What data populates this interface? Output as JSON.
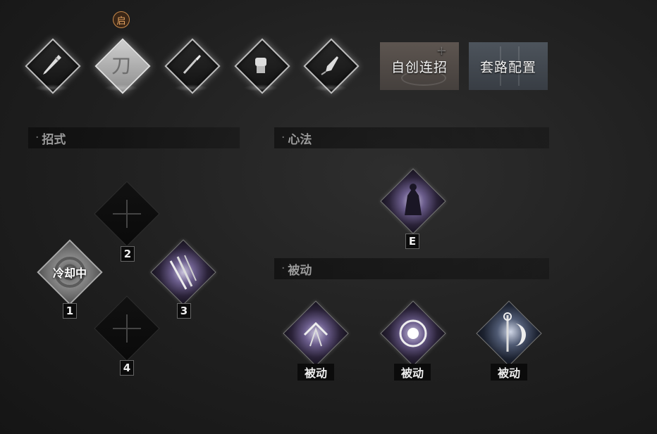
{
  "weapons": [
    {
      "name": "sword",
      "active": false
    },
    {
      "name": "blade",
      "active": true,
      "char": "刀"
    },
    {
      "name": "spear",
      "active": false
    },
    {
      "name": "fist",
      "active": false
    },
    {
      "name": "dart",
      "active": false
    }
  ],
  "badge": {
    "label": "启"
  },
  "buttons": {
    "create_combo": "自创连招",
    "route_config": "套路配置"
  },
  "sections": {
    "moves": "招式",
    "mind": "心法",
    "passive": "被动",
    "dot": "·"
  },
  "moves": [
    {
      "slot": "1",
      "state": "cooling",
      "status": "冷却中"
    },
    {
      "slot": "2",
      "state": "empty"
    },
    {
      "slot": "3",
      "state": "filled"
    },
    {
      "slot": "4",
      "state": "empty"
    }
  ],
  "mind": {
    "key": "E"
  },
  "passives": [
    {
      "label": "被动"
    },
    {
      "label": "被动"
    },
    {
      "label": "被动"
    }
  ],
  "colors": {
    "badge": "#e9a864",
    "accent_purple": "#6b5d8c"
  }
}
